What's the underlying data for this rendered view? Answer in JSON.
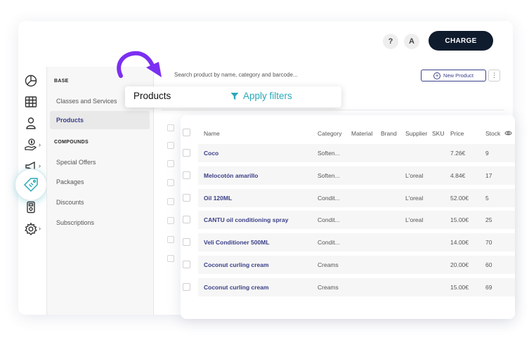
{
  "header": {
    "help_label": "?",
    "avatar_initial": "A",
    "charge_label": "CHARGE"
  },
  "rail": {
    "icons": [
      "reports-icon",
      "calendar-icon",
      "user-icon",
      "money-hand-icon",
      "megaphone-icon",
      "tag-icon",
      "cash-register-icon",
      "gear-icon"
    ],
    "chevron": "›"
  },
  "subnav": {
    "base_label": "BASE",
    "items_base": [
      "Classes and Services",
      "Products"
    ],
    "compounds_label": "COMPOUNDS",
    "items_compounds": [
      "Special Offers",
      "Packages",
      "Discounts",
      "Subscriptions"
    ]
  },
  "search": {
    "placeholder": "Search product by name, category and barcode..."
  },
  "toolbar": {
    "new_product_label": "New Product",
    "more_label": "⋮"
  },
  "callout": {
    "title": "Products",
    "filters_label": "Apply filters"
  },
  "colors": {
    "accent": "#3a3f87",
    "teal": "#2aa9b8",
    "arrow": "#7b2ff2",
    "dark": "#0f1c2e"
  },
  "table": {
    "columns": [
      "Name",
      "Category",
      "Material",
      "Brand",
      "Supplier",
      "SKU",
      "Price",
      "Stock"
    ],
    "rows": [
      {
        "name": "Coco",
        "category": "Soften...",
        "supplier": "",
        "price": "7.26€",
        "stock": "9"
      },
      {
        "name": "Melocotón amarillo",
        "category": "Soften...",
        "supplier": "L'oreal",
        "price": "4.84€",
        "stock": "17"
      },
      {
        "name": "Oil 120ML",
        "category": "Condit...",
        "supplier": "L'oreal",
        "price": "52.00€",
        "stock": "5"
      },
      {
        "name": "CANTU oil conditioning spray",
        "category": "Condit...",
        "supplier": "L'oreal",
        "price": "15.00€",
        "stock": "25"
      },
      {
        "name": "Veli Conditioner 500ML",
        "category": "Condit...",
        "supplier": "",
        "price": "14.00€",
        "stock": "70"
      },
      {
        "name": "Coconut curling cream",
        "category": "Creams",
        "supplier": "",
        "price": "20.00€",
        "stock": "60"
      },
      {
        "name": "Coconut curling cream",
        "category": "Creams",
        "supplier": "",
        "price": "15.00€",
        "stock": "69"
      }
    ]
  }
}
